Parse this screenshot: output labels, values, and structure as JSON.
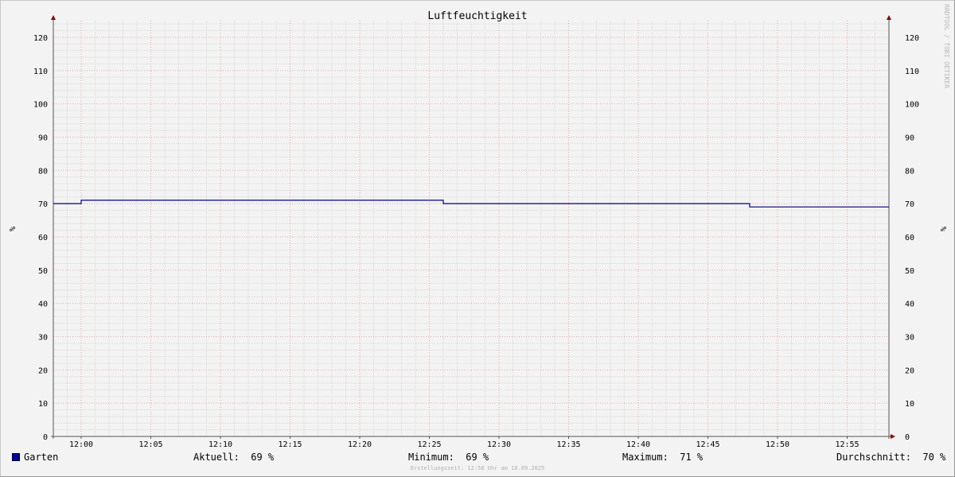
{
  "chart_data": {
    "type": "line",
    "title": "Luftfeuchtigkeit",
    "ylabel": "%",
    "ylabel_right": "%",
    "ylim": [
      0,
      125
    ],
    "yticks": [
      0,
      10,
      20,
      30,
      40,
      50,
      60,
      70,
      80,
      90,
      100,
      110,
      120
    ],
    "xlim": [
      "11:58",
      "12:58"
    ],
    "xticks": [
      "12:00",
      "12:05",
      "12:10",
      "12:15",
      "12:20",
      "12:25",
      "12:30",
      "12:35",
      "12:40",
      "12:45",
      "12:50",
      "12:55"
    ],
    "grid": true,
    "series": [
      {
        "name": "Garten",
        "color": "#000080",
        "points": [
          {
            "x": "11:58",
            "y": 70
          },
          {
            "x": "12:00",
            "y": 70
          },
          {
            "x": "12:00",
            "y": 71
          },
          {
            "x": "12:26",
            "y": 71
          },
          {
            "x": "12:26",
            "y": 70
          },
          {
            "x": "12:48",
            "y": 70
          },
          {
            "x": "12:48",
            "y": 69
          },
          {
            "x": "12:58",
            "y": 69
          }
        ]
      }
    ]
  },
  "legend": {
    "series_name": "Garten",
    "swatch_color": "#0000a0",
    "current": "Aktuell:  69 %",
    "minimum": "Minimum:  69 %",
    "maximum": "Maximum:  71 %",
    "average": "Durchschnitt:  70 %"
  },
  "watermark": "RRDTOOL / TOBI OETIKER",
  "footer": "Erstellungszeit: 12:58 Uhr am 18.09.2025"
}
